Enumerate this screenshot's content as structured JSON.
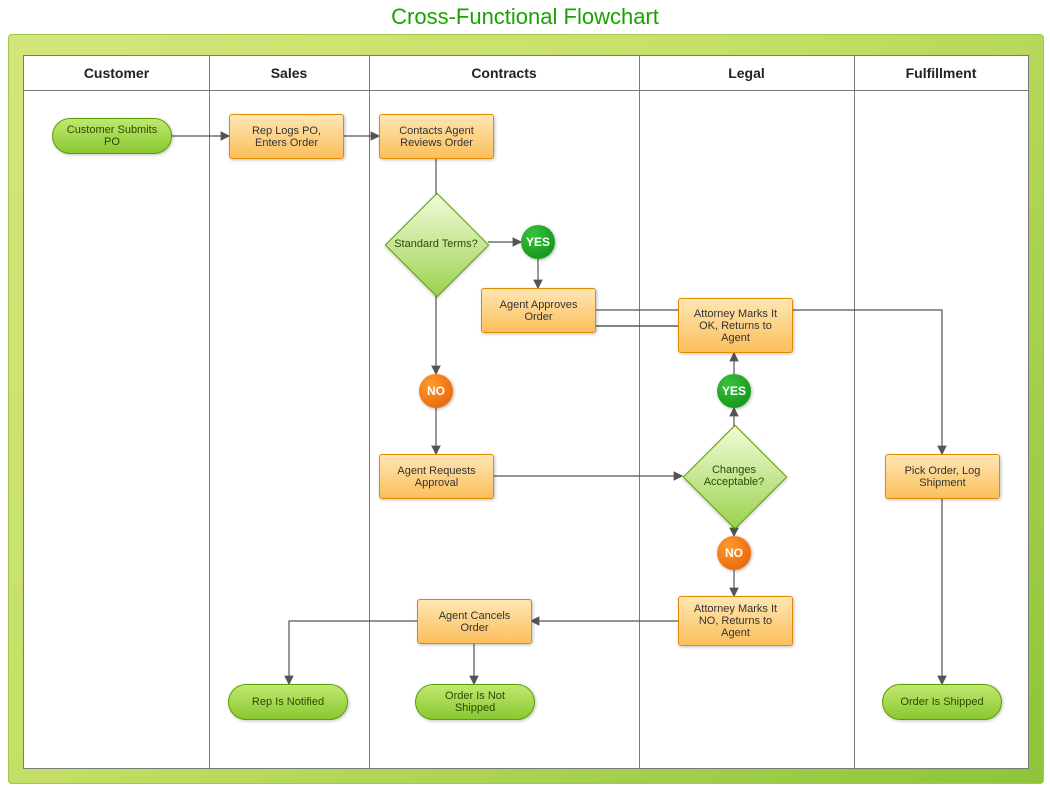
{
  "title": "Cross-Functional Flowchart",
  "lanes": {
    "customer": "Customer",
    "sales": "Sales",
    "contracts": "Contracts",
    "legal": "Legal",
    "fulfillment": "Fulfillment"
  },
  "nodes": {
    "customer_submits": "Customer Submits PO",
    "rep_logs": "Rep Logs PO, Enters Order",
    "contacts_agent": "Contacts Agent Reviews Order",
    "standard_terms": "Standard Terms?",
    "yes1": "YES",
    "agent_approves": "Agent Approves Order",
    "no1": "NO",
    "agent_requests": "Agent Requests Approval",
    "changes_acceptable": "Changes Acceptable?",
    "yes2": "YES",
    "attorney_ok": "Attorney Marks It OK, Returns to Agent",
    "no2": "NO",
    "attorney_no": "Attorney Marks It NO, Returns to Agent",
    "agent_cancels": "Agent Cancels Order",
    "rep_notified": "Rep Is Notified",
    "order_not_shipped": "Order Is Not Shipped",
    "pick_order": "Pick Order, Log Shipment",
    "order_shipped": "Order Is Shipped"
  }
}
